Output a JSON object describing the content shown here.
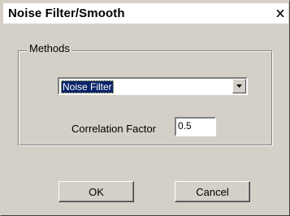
{
  "window": {
    "title": "Noise Filter/Smooth",
    "close_icon": "close-icon"
  },
  "methods": {
    "group_label": "Methods",
    "selected_method": "Noise Filter",
    "dropdown_icon": "chevron-down-icon"
  },
  "correlation": {
    "label": "Correlation Factor",
    "value": "0.5"
  },
  "buttons": {
    "ok_label": "OK",
    "cancel_label": "Cancel"
  },
  "colors": {
    "dialog_face": "#d4d0c8",
    "selection_bg": "#0a246a",
    "selection_fg": "#ffffff"
  }
}
